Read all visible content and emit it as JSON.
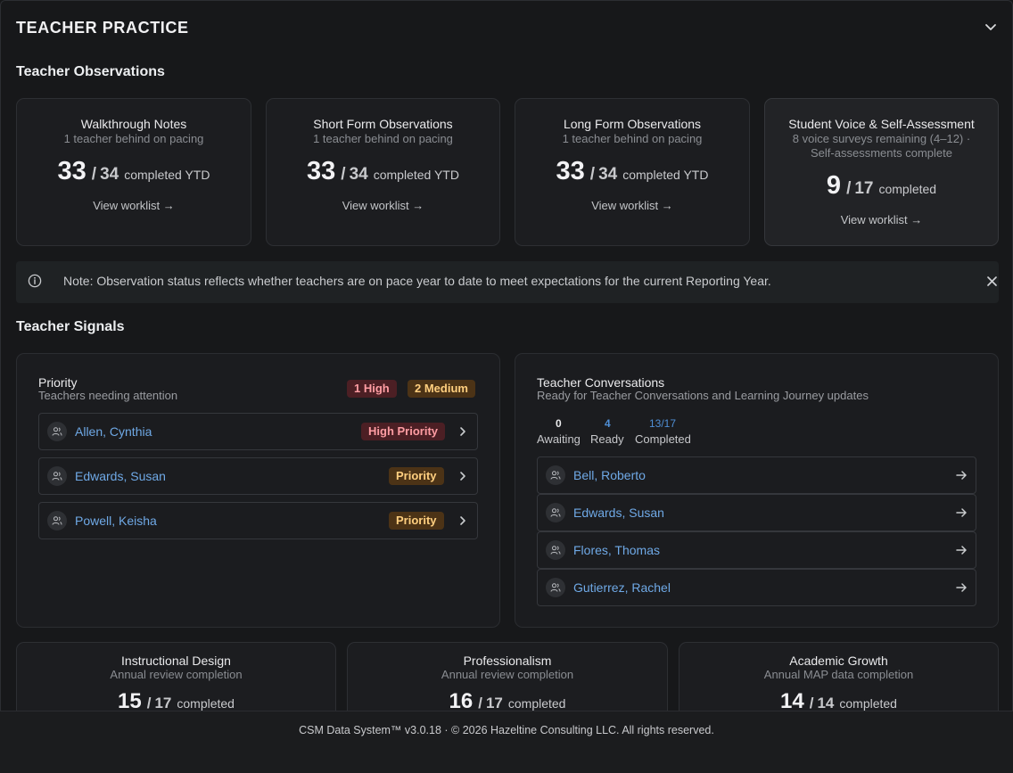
{
  "header": {
    "title": "TEACHER PRACTICE"
  },
  "observations": {
    "section_title": "Teacher Observations",
    "cards": [
      {
        "title": "Walkthrough Notes",
        "sub": "1 teacher behind on pacing",
        "value": "33",
        "sep": "/",
        "total": "34",
        "label": "completed YTD",
        "link": "View worklist →"
      },
      {
        "title": "Short Form Observations",
        "sub": "1 teacher behind on pacing",
        "value": "33",
        "sep": "/",
        "total": "34",
        "label": "completed YTD",
        "link": "View worklist →"
      },
      {
        "title": "Long Form Observations",
        "sub": "1 teacher behind on pacing",
        "value": "33",
        "sep": "/",
        "total": "34",
        "label": "completed YTD",
        "link": "View worklist →"
      },
      {
        "title": "Student Voice & Self-Assessment",
        "sub1": "8 voice surveys remaining (4–12) ·",
        "sub2": "Self-assessments complete",
        "value": "9",
        "sep": "/",
        "total": "17",
        "label": "completed",
        "link": "View worklist →"
      }
    ]
  },
  "note": {
    "text": "Note: Observation status reflects whether teachers are on pace year to date to meet expectations for the current Reporting Year."
  },
  "signals": {
    "section_title": "Teacher Signals",
    "priority": {
      "title": "Priority",
      "sub": "Teachers needing attention",
      "badge_high": "1 High",
      "badge_medium": "2 Medium",
      "rows": [
        {
          "name": "Allen, Cynthia",
          "tag": "High Priority"
        },
        {
          "name": "Edwards, Susan",
          "tag": "Priority"
        },
        {
          "name": "Powell, Keisha",
          "tag": "Priority"
        }
      ]
    },
    "conversations": {
      "title": "Teacher Conversations",
      "sub": "Ready for Teacher Conversations and Learning Journey updates",
      "stats": [
        {
          "value": "0",
          "label": "Awaiting"
        },
        {
          "value": "4",
          "label": "Ready"
        },
        {
          "value": "13/17",
          "label": "Completed"
        }
      ],
      "rows": [
        {
          "name": "Bell, Roberto"
        },
        {
          "name": "Edwards, Susan"
        },
        {
          "name": "Flores, Thomas"
        },
        {
          "name": "Gutierrez, Rachel"
        }
      ]
    }
  },
  "reviews": {
    "cards": [
      {
        "title": "Instructional Design",
        "sub": "Annual review completion",
        "value": "15",
        "sep": "/",
        "total": "17",
        "label": "completed"
      },
      {
        "title": "Professionalism",
        "sub": "Annual review completion",
        "value": "16",
        "sep": "/",
        "total": "17",
        "label": "completed"
      },
      {
        "title": "Academic Growth",
        "sub": "Annual MAP data completion",
        "value": "14",
        "sep": "/",
        "total": "14",
        "label": "completed"
      }
    ]
  },
  "footer": {
    "text": "CSM Data System™ v3.0.18 · © 2026 Hazeltine Consulting LLC. All rights reserved."
  },
  "colors": {
    "link": "#6fa9e6",
    "high": "#ff9da3",
    "medium": "#ffcf7f",
    "stat_blue": "#4f8fd6"
  },
  "icons": [
    "chevron-down-icon",
    "info-icon",
    "close-icon",
    "users-icon",
    "chevron-right-icon",
    "arrow-right-icon"
  ]
}
